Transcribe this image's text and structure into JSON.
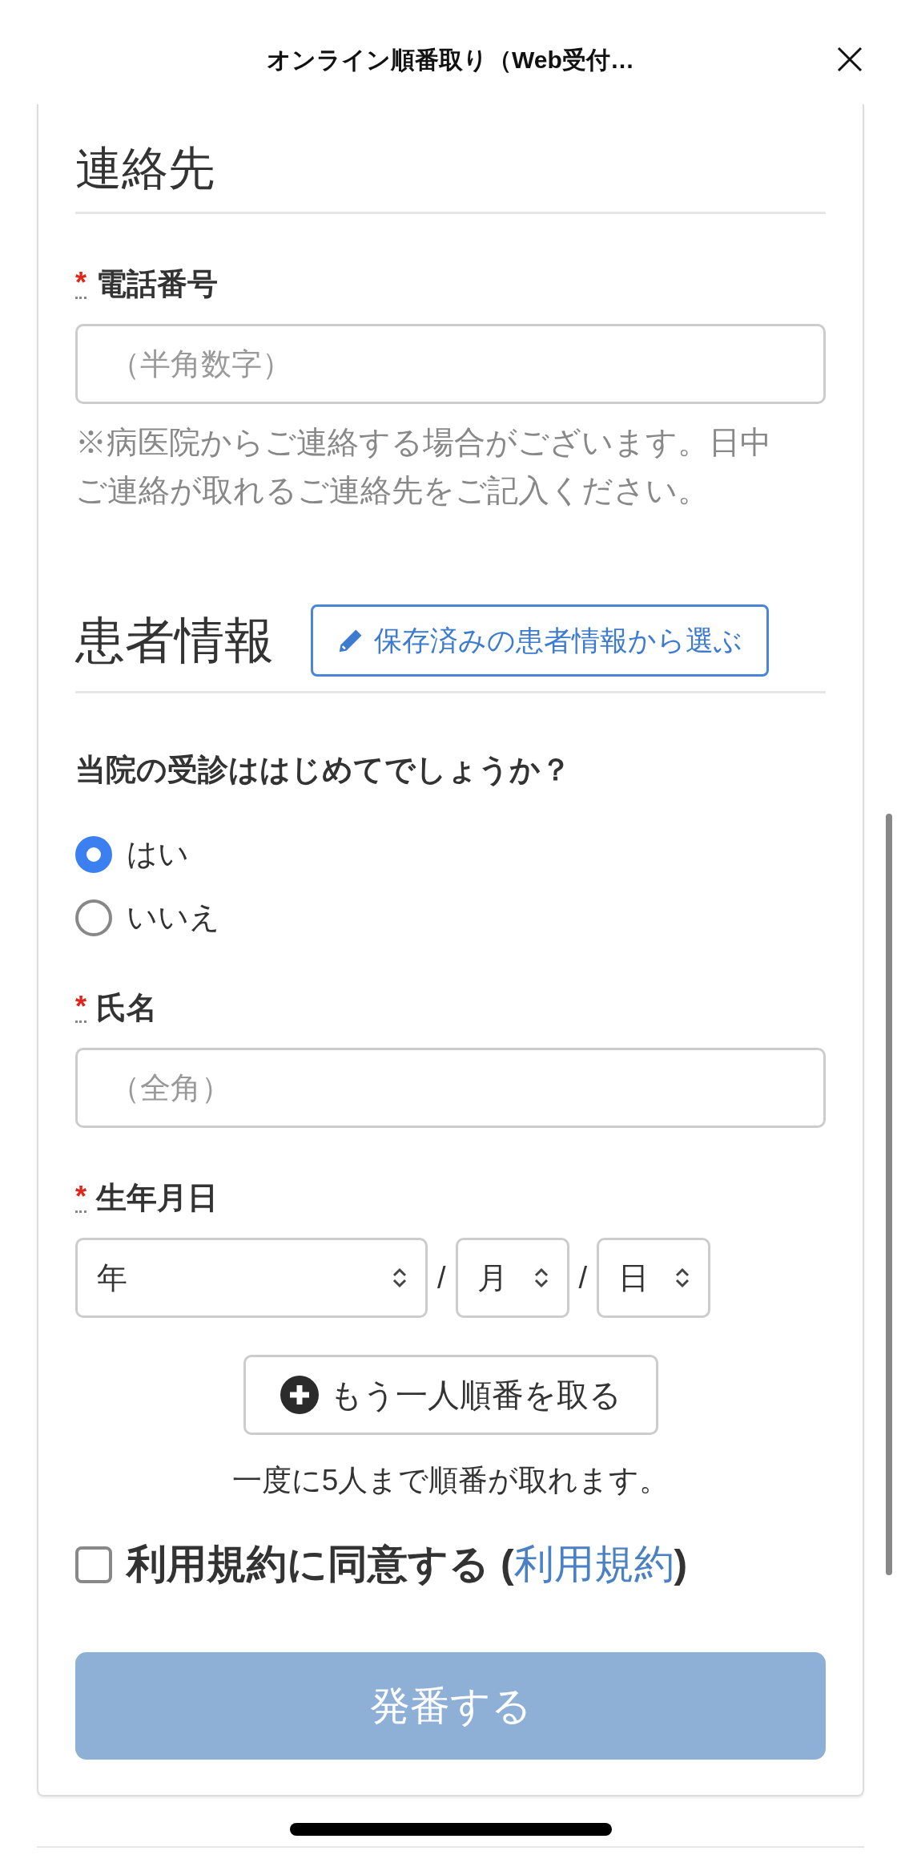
{
  "header": {
    "title": "オンライン順番取り（Web受付…"
  },
  "contact": {
    "heading": "連絡先",
    "phone": {
      "label": "電話番号",
      "required_mark": "*",
      "placeholder": "（半角数字）"
    },
    "note": "※病医院からご連絡する場合がございます。日中ご連絡が取れるご連絡先をご記入ください。"
  },
  "patient": {
    "heading": "患者情報",
    "saved_button": "保存済みの患者情報から選ぶ",
    "question": "当院の受診ははじめてでしょうか？",
    "options": [
      {
        "label": "はい",
        "selected": true
      },
      {
        "label": "いいえ",
        "selected": false
      }
    ],
    "name": {
      "label": "氏名",
      "required_mark": "*",
      "placeholder": "（全角）"
    },
    "birthdate": {
      "label": "生年月日",
      "required_mark": "*",
      "selects": [
        {
          "value": "年",
          "kind": "wide"
        },
        {
          "value": "月",
          "kind": "narrow"
        },
        {
          "value": "日",
          "kind": "narrow"
        }
      ],
      "separators": [
        "/",
        "/"
      ]
    },
    "add_button": "もう一人順番を取る",
    "add_note": "一度に5人まで順番が取れます。"
  },
  "agree": {
    "label": "利用規約に同意する",
    "open": "(",
    "link": "利用規約",
    "close": ")",
    "checked": false
  },
  "submit": {
    "label": "発番する",
    "disabled": true
  }
}
